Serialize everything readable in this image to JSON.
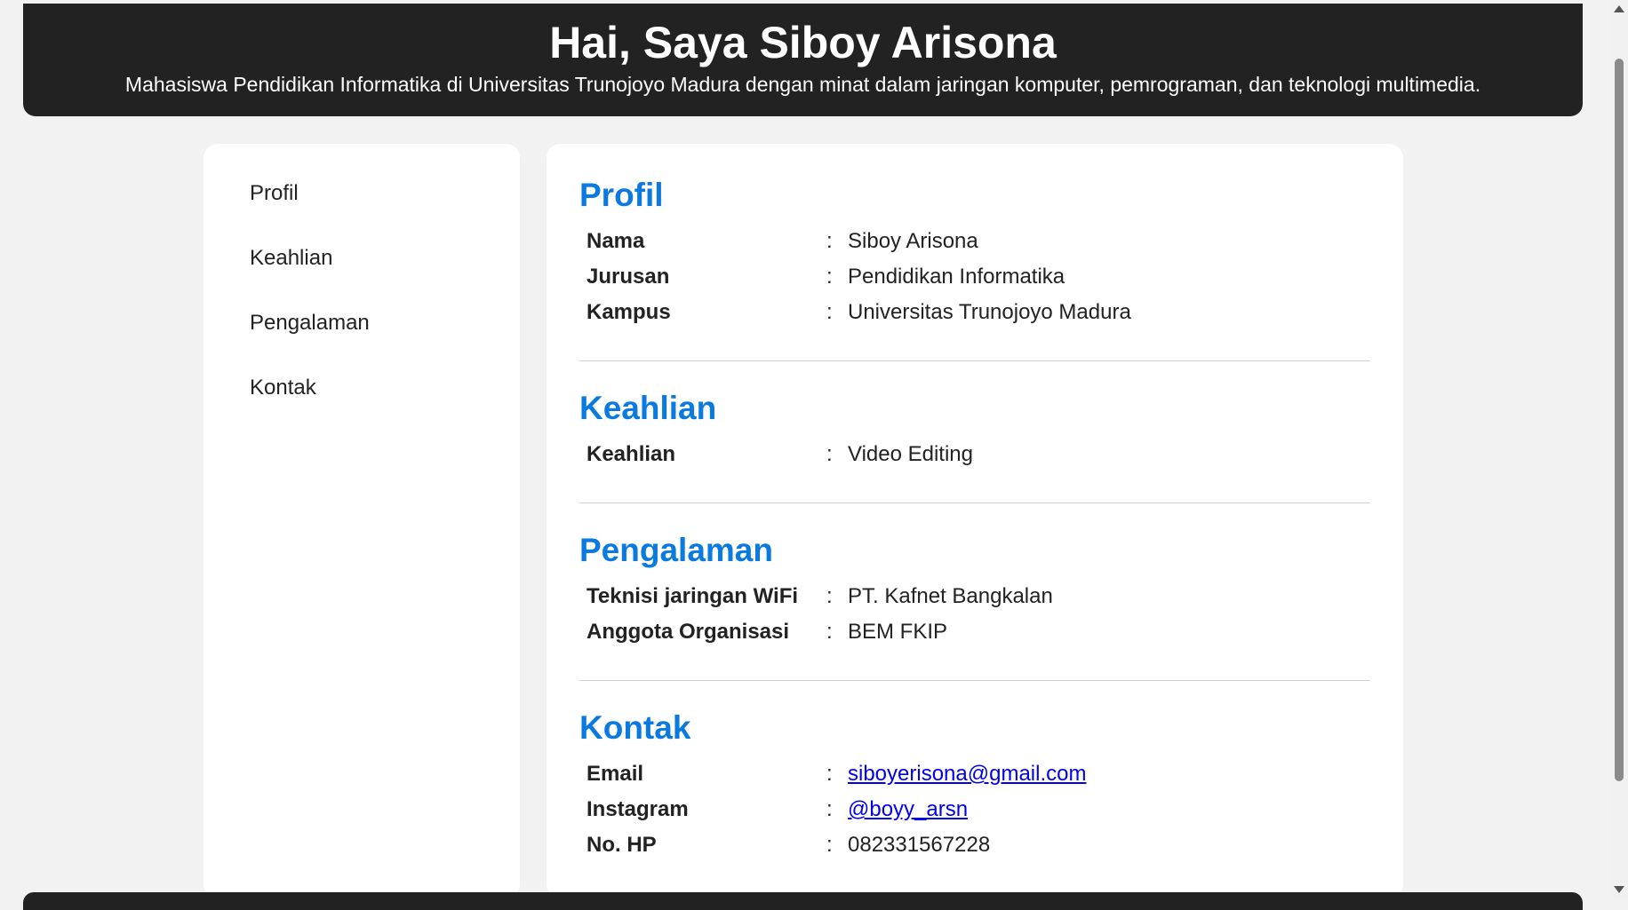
{
  "header": {
    "title": "Hai, Saya Siboy Arisona",
    "subtitle": "Mahasiswa Pendidikan Informatika di Universitas Trunojoyo Madura dengan minat dalam jaringan komputer, pemrograman, dan teknologi multimedia."
  },
  "nav": {
    "items": [
      "Profil",
      "Keahlian",
      "Pengalaman",
      "Kontak"
    ]
  },
  "sections": {
    "profil": {
      "heading": "Profil",
      "rows": [
        {
          "label": "Nama",
          "value": "Siboy Arisona"
        },
        {
          "label": "Jurusan",
          "value": "Pendidikan Informatika"
        },
        {
          "label": "Kampus",
          "value": "Universitas Trunojoyo Madura"
        }
      ]
    },
    "keahlian": {
      "heading": "Keahlian",
      "rows": [
        {
          "label": "Keahlian",
          "value": "Video Editing"
        }
      ]
    },
    "pengalaman": {
      "heading": "Pengalaman",
      "rows": [
        {
          "label": "Teknisi jaringan WiFi",
          "value": "PT. Kafnet Bangkalan"
        },
        {
          "label": "Anggota Organisasi",
          "value": "BEM FKIP"
        }
      ]
    },
    "kontak": {
      "heading": "Kontak",
      "rows": [
        {
          "label": "Email",
          "value": "siboyerisona@gmail.com"
        },
        {
          "label": "Instagram",
          "value": "@boyy_arsn"
        },
        {
          "label": "No. HP",
          "value": "082331567228"
        }
      ]
    }
  },
  "separator": ":",
  "colors": {
    "header_bg": "#222222",
    "accent": "#0b7ae0",
    "link": "#0000ee",
    "page_bg": "#f2f2f2"
  }
}
